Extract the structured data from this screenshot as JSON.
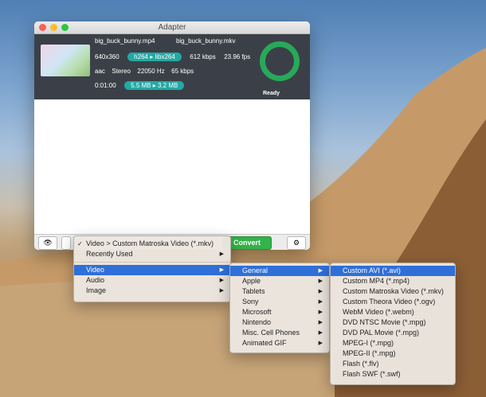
{
  "window": {
    "title": "Adapter"
  },
  "item": {
    "input_name": "big_buck_bunny.mp4",
    "output_name": "big_buck_bunny.mkv",
    "resolution": "640x360",
    "codec_in": "h264",
    "codec_out": "libx264",
    "bitrate": "612 kbps",
    "fps": "23.96 fps",
    "audio_codec": "aac",
    "audio_channels": "Stereo",
    "audio_rate": "22050 Hz",
    "audio_bitrate": "65 kbps",
    "duration": "0:01:00",
    "size_in": "5.5 MB",
    "size_out": "3.2 MB",
    "status": "Ready",
    "status_color": "#27a95a"
  },
  "toolbar": {
    "convert_label": "Convert",
    "eye_icon": "eye-icon",
    "settings_icon": "gear-icon"
  },
  "menu1": {
    "checked_item": "Video > Custom Matroska Video (*.mkv)",
    "recent": "Recently Used",
    "categories": [
      "Video",
      "Audio",
      "Image"
    ]
  },
  "menu2": {
    "items": [
      "General",
      "Apple",
      "Tablets",
      "Sony",
      "Microsoft",
      "Nintendo",
      "Misc. Cell Phones",
      "Animated GIF"
    ]
  },
  "menu3": {
    "items": [
      "Custom AVI (*.avi)",
      "Custom MP4 (*.mp4)",
      "Custom Matroska Video (*.mkv)",
      "Custom Theora Video (*.ogv)",
      "WebM Video (*.webm)",
      "DVD NTSC Movie (*.mpg)",
      "DVD PAL Movie (*.mpg)",
      "MPEG-I (*.mpg)",
      "MPEG-II (*.mpg)",
      "Flash (*.flv)",
      "Flash SWF (*.swf)"
    ]
  },
  "colors": {
    "accent": "#2f6fd8",
    "pill": "#23a9a4",
    "convert": "#35b24a"
  }
}
